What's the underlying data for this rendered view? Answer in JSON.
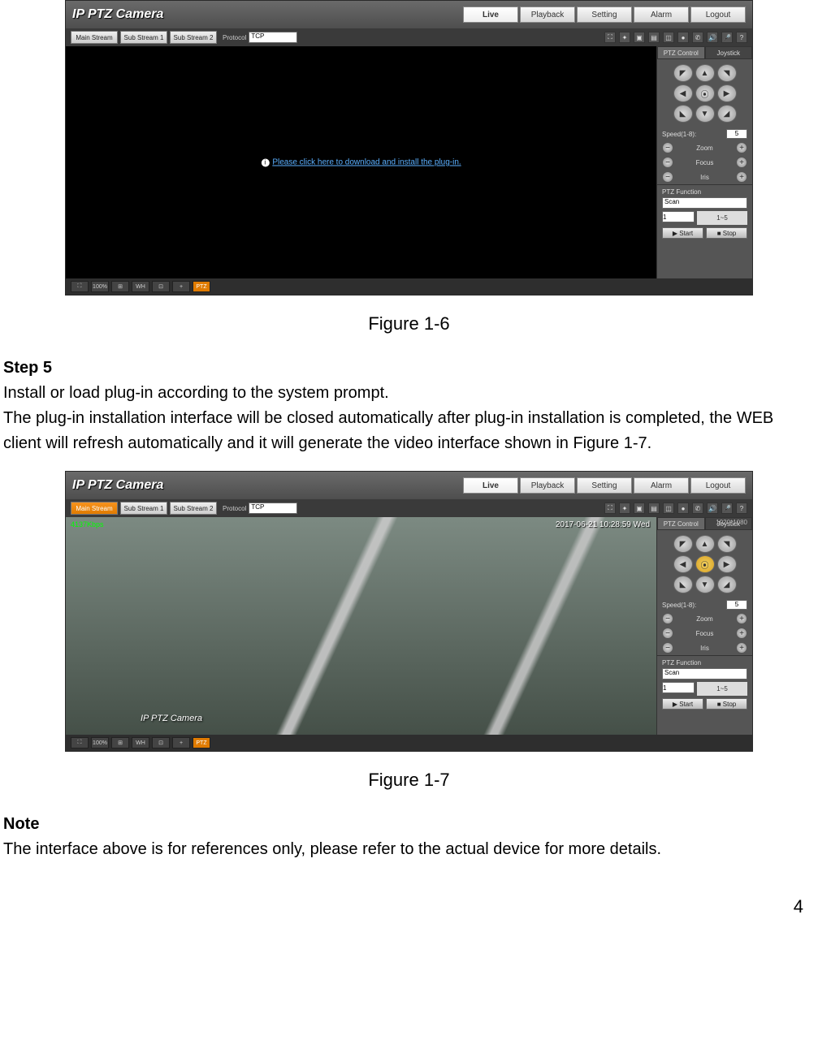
{
  "app": {
    "title": "IP PTZ Camera",
    "nav": [
      "Live",
      "Playback",
      "Setting",
      "Alarm",
      "Logout"
    ],
    "streams": [
      "Main Stream",
      "Sub Stream 1",
      "Sub Stream 2"
    ],
    "protocol_label": "Protocol",
    "protocol_value": "TCP",
    "plugin_prefix": "",
    "plugin_link": "Please click here to download and install the plug-in.",
    "bitrate": "4137Kbps",
    "resolution": "1920*1080",
    "osd_time": "2017-06-21 10:28:59 Wed",
    "watermark": "IP PTZ Camera",
    "ptz_tabs": [
      "PTZ Control",
      "Joystick"
    ],
    "ptz_speed_label": "Speed(1-8):",
    "ptz_speed_value": "5",
    "ptz_zoom": "Zoom",
    "ptz_focus": "Focus",
    "ptz_iris": "Iris",
    "ptz_func_label": "PTZ Function",
    "ptz_func_value": "Scan",
    "ptz_preset": "1",
    "ptz_range": "1~5",
    "ptz_start": "▶ Start",
    "ptz_stop": "■ Stop",
    "footer_btns": [
      "⛶",
      "100%",
      "⊞",
      "WH",
      "⊡",
      "+",
      "PTZ"
    ]
  },
  "doc": {
    "fig1": "Figure 1-6",
    "step5": "Step 5",
    "step5_l1": "Install or load plug-in according to the system prompt.",
    "step5_l2": "The plug-in installation interface will be closed automatically after plug-in installation is completed, the WEB client will refresh automatically and it will generate the video interface shown in Figure 1-7.",
    "fig2": "Figure 1-7",
    "note": "Note",
    "note_text": "The interface above is for references only, please refer to the actual device for more details.",
    "page_num": "4"
  }
}
